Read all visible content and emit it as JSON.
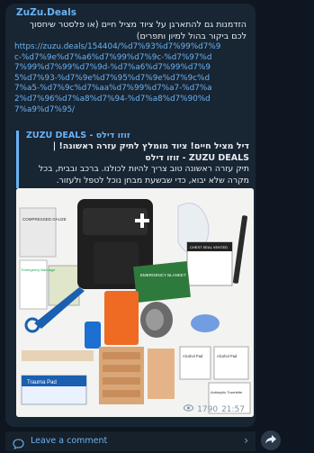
{
  "post": {
    "channel_name": "ZuZu.Deals",
    "intro_text": "הזדמנות גם להתארגן על ציוד מציל חיים (או פלסטר שיחסוך לכם ביקור בהול למיון ותפרים)",
    "link": "https://zuzu.deals/154404/%d7%93%d7%99%d7%9c-%d7%9e%d7%a6%d7%99%d7%9c-%d7%97%d7%99%d7%99%d7%9d-%d7%a6%d7%99%d7%95%d7%93-%d7%9e%d7%95%d7%9e%d7%9c%d7%a5-%d7%9c%d7%aa%d7%99%d7%a7-%d7%a2%d7%96%d7%a8%d7%94-%d7%a8%d7%90%d7%a9%d7%95/"
  },
  "preview": {
    "site_name": "ZUZU DEALS - זוזו דילס",
    "title": "דיל מציל חיים! ציוד מומלץ לתיק עזרה ראשונה! | ZUZU DEALS - זוזו דילס",
    "description": "תיק עזרה ראשונה טוב צריך להיות לכולנו. ברכב ובבית, בכל מקרה שלא יבוא, כדי שבשעת מבחן נוכל לטפל ולעזור."
  },
  "photo": {
    "labels": {
      "gauze": "COMPRESSED GAUZE",
      "bandage": "Emergency Bandage",
      "chest_seal": "CHEST SEAL VENTED",
      "blanket": "EMERGENCY BLANKET",
      "alcohol1": "Alcohol Pad",
      "alcohol2": "Alcohol Pad",
      "trauma": "Trauma Pad",
      "antiseptic": "Antiseptic Towelette"
    }
  },
  "meta": {
    "views": "1790",
    "time": "21:57"
  },
  "comment": {
    "label": "Leave a comment"
  },
  "colors": {
    "accent": "#6ab3f3",
    "bubble": "#182533",
    "background": "#0e1621"
  }
}
